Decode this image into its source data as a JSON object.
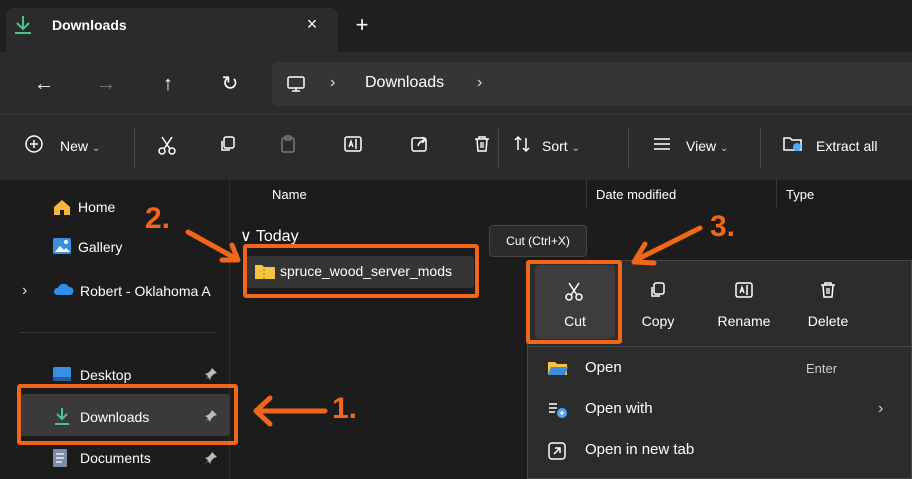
{
  "window": {
    "tab_title": "Downloads",
    "tab_close": "×",
    "new_tab": "+"
  },
  "address": {
    "separator": "›",
    "segment": "Downloads"
  },
  "toolbar": {
    "new_label": "New",
    "sort_label": "Sort",
    "view_label": "View",
    "extract_label": "Extract all",
    "chevron": "⌄"
  },
  "sidebar": {
    "items": [
      {
        "label": "Home"
      },
      {
        "label": "Gallery"
      },
      {
        "label": "Robert - Oklahoma A"
      },
      {
        "label": "Desktop"
      },
      {
        "label": "Downloads"
      },
      {
        "label": "Documents"
      }
    ],
    "expand_chevron": "›",
    "pin": "📌"
  },
  "columns": {
    "name": "Name",
    "date_modified": "Date modified",
    "type": "Type"
  },
  "group": {
    "label": "Today",
    "chevron": "∨"
  },
  "file": {
    "name": "spruce_wood_server_mods"
  },
  "tooltip": {
    "text": "Cut (Ctrl+X)"
  },
  "context_menu": {
    "actions": [
      {
        "label": "Cut"
      },
      {
        "label": "Copy"
      },
      {
        "label": "Rename"
      },
      {
        "label": "Delete"
      }
    ],
    "rows": [
      {
        "label": "Open",
        "shortcut": "Enter"
      },
      {
        "label": "Open with",
        "submenu": "›"
      },
      {
        "label": "Open in new tab"
      }
    ]
  },
  "annotations": {
    "step1": "1.",
    "step2": "2.",
    "step3": "3.",
    "color": "#f0661a"
  },
  "colors": {
    "accent_blue": "#4aa8ff",
    "folder_yellow": "#f5c542",
    "green_download": "#4cc38a"
  }
}
